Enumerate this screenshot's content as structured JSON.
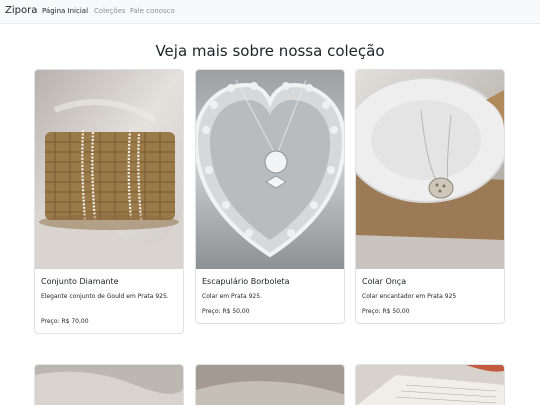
{
  "navbar": {
    "brand": "Zipora",
    "links": [
      {
        "label": "Página Inicial",
        "active": true
      },
      {
        "label": "Coleções",
        "active": false
      },
      {
        "label": "Fale conosco",
        "active": false
      }
    ]
  },
  "main": {
    "heading": "Veja mais sobre nossa coleção",
    "products": [
      {
        "title": "Conjunto Diamante",
        "description": "Elegante conjunto de Gould em Prata 925.",
        "price": "Preço: R$ 70,00"
      },
      {
        "title": "Escapulário Borboleta",
        "description": "Colar em Prata 925.",
        "price": "Preço: R$ 50,00"
      },
      {
        "title": "Colar Onça",
        "description": "Colar encantador em Prata 925",
        "price": "Preço: R$ 50,00"
      }
    ]
  },
  "colors": {
    "navbar_bg": "#f8f9fa",
    "link_active": "#212529",
    "link_muted": "#8a8f94",
    "card_border": "#dfe2e5"
  }
}
